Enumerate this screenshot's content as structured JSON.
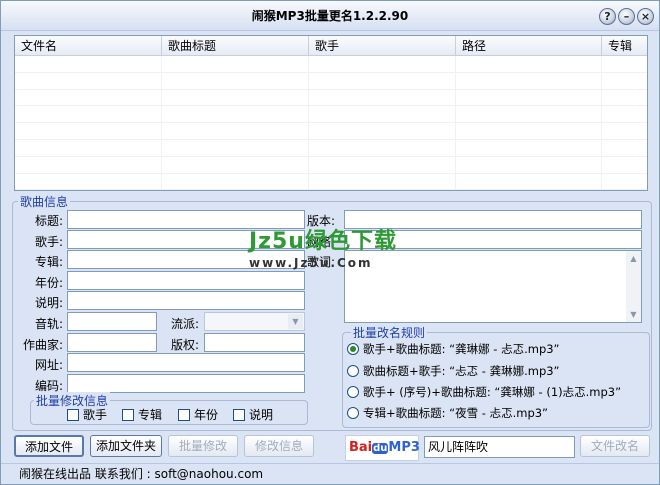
{
  "window": {
    "title": "闹猴MP3批量更名1.2.2.90",
    "buttons": {
      "help": "?",
      "minimize": "–",
      "close": "×"
    }
  },
  "list": {
    "columns": [
      "文件名",
      "歌曲标题",
      "歌手",
      "路径",
      "专辑"
    ]
  },
  "song_info": {
    "group_label": "歌曲信息",
    "labels": {
      "title": "标题:",
      "artist": "歌手:",
      "album": "专辑:",
      "year": "年份:",
      "comment": "说明:",
      "track": "音轨:",
      "genre": "流派:",
      "composer": "作曲家:",
      "copyright": "版权:",
      "url": "网址:",
      "encoder": "编码:",
      "version": "版本:",
      "unknown": "网络:",
      "lyrics": "歌词:"
    }
  },
  "batch_modify": {
    "group_label": "批量修改信息",
    "checks": [
      "歌手",
      "专辑",
      "年份",
      "说明"
    ]
  },
  "rename_rules": {
    "group_label": "批量改名规则",
    "options": [
      "歌手+歌曲标题: “龚琳娜 - 忐忑.mp3”",
      "歌曲标题+歌手: “忐忑 - 龚琳娜.mp3”",
      "歌手+ (序号)+歌曲标题: “龚琳娜 - (1)忐忑.mp3”",
      "专辑+歌曲标题: “夜雪 - 忐忑.mp3”"
    ]
  },
  "buttons": {
    "add_file": "添加文件",
    "add_folder": "添加文件夹",
    "batch_modify": "批量修改",
    "modify_info": "修改信息",
    "file_rename": "文件改名"
  },
  "search": {
    "brand": "Bai du MP3",
    "value": "风儿阵阵吹"
  },
  "statusbar": "闹猴在线出品   联系我们 :  soft@naohou.com",
  "watermark": {
    "main": "Jz5u绿色下载",
    "sub": "www.Jz5u.Com"
  }
}
